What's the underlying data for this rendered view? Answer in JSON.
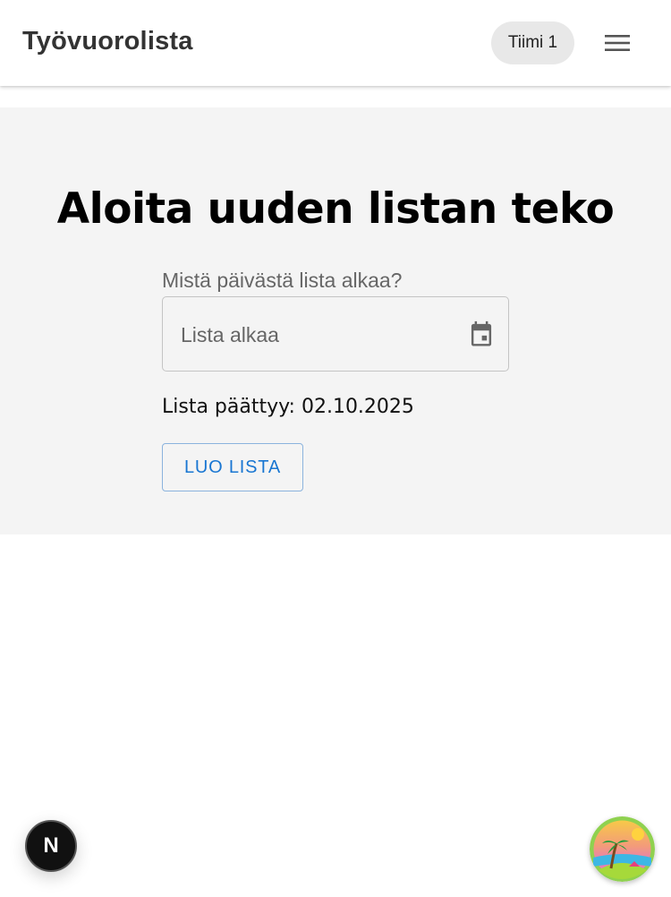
{
  "header": {
    "title": "Työvuorolista",
    "team_label": "Tiimi 1",
    "menu_icon": "hamburger-menu-icon"
  },
  "form": {
    "heading": "Aloita uuden listan teko",
    "start_label": "Mistä päivästä lista alkaa?",
    "start_placeholder": "Lista alkaa",
    "start_value": "",
    "calendar_icon": "calendar-icon",
    "end_text": "Lista päättyy: 02.10.2025",
    "create_button": "LUO LISTA"
  },
  "floating": {
    "dev_badge_letter": "N",
    "avatar_icon": "tropical-island-icon"
  },
  "colors": {
    "accent": "#1976d2",
    "panel_bg": "#f4f4f4",
    "chip_bg": "#e8e8e8"
  }
}
